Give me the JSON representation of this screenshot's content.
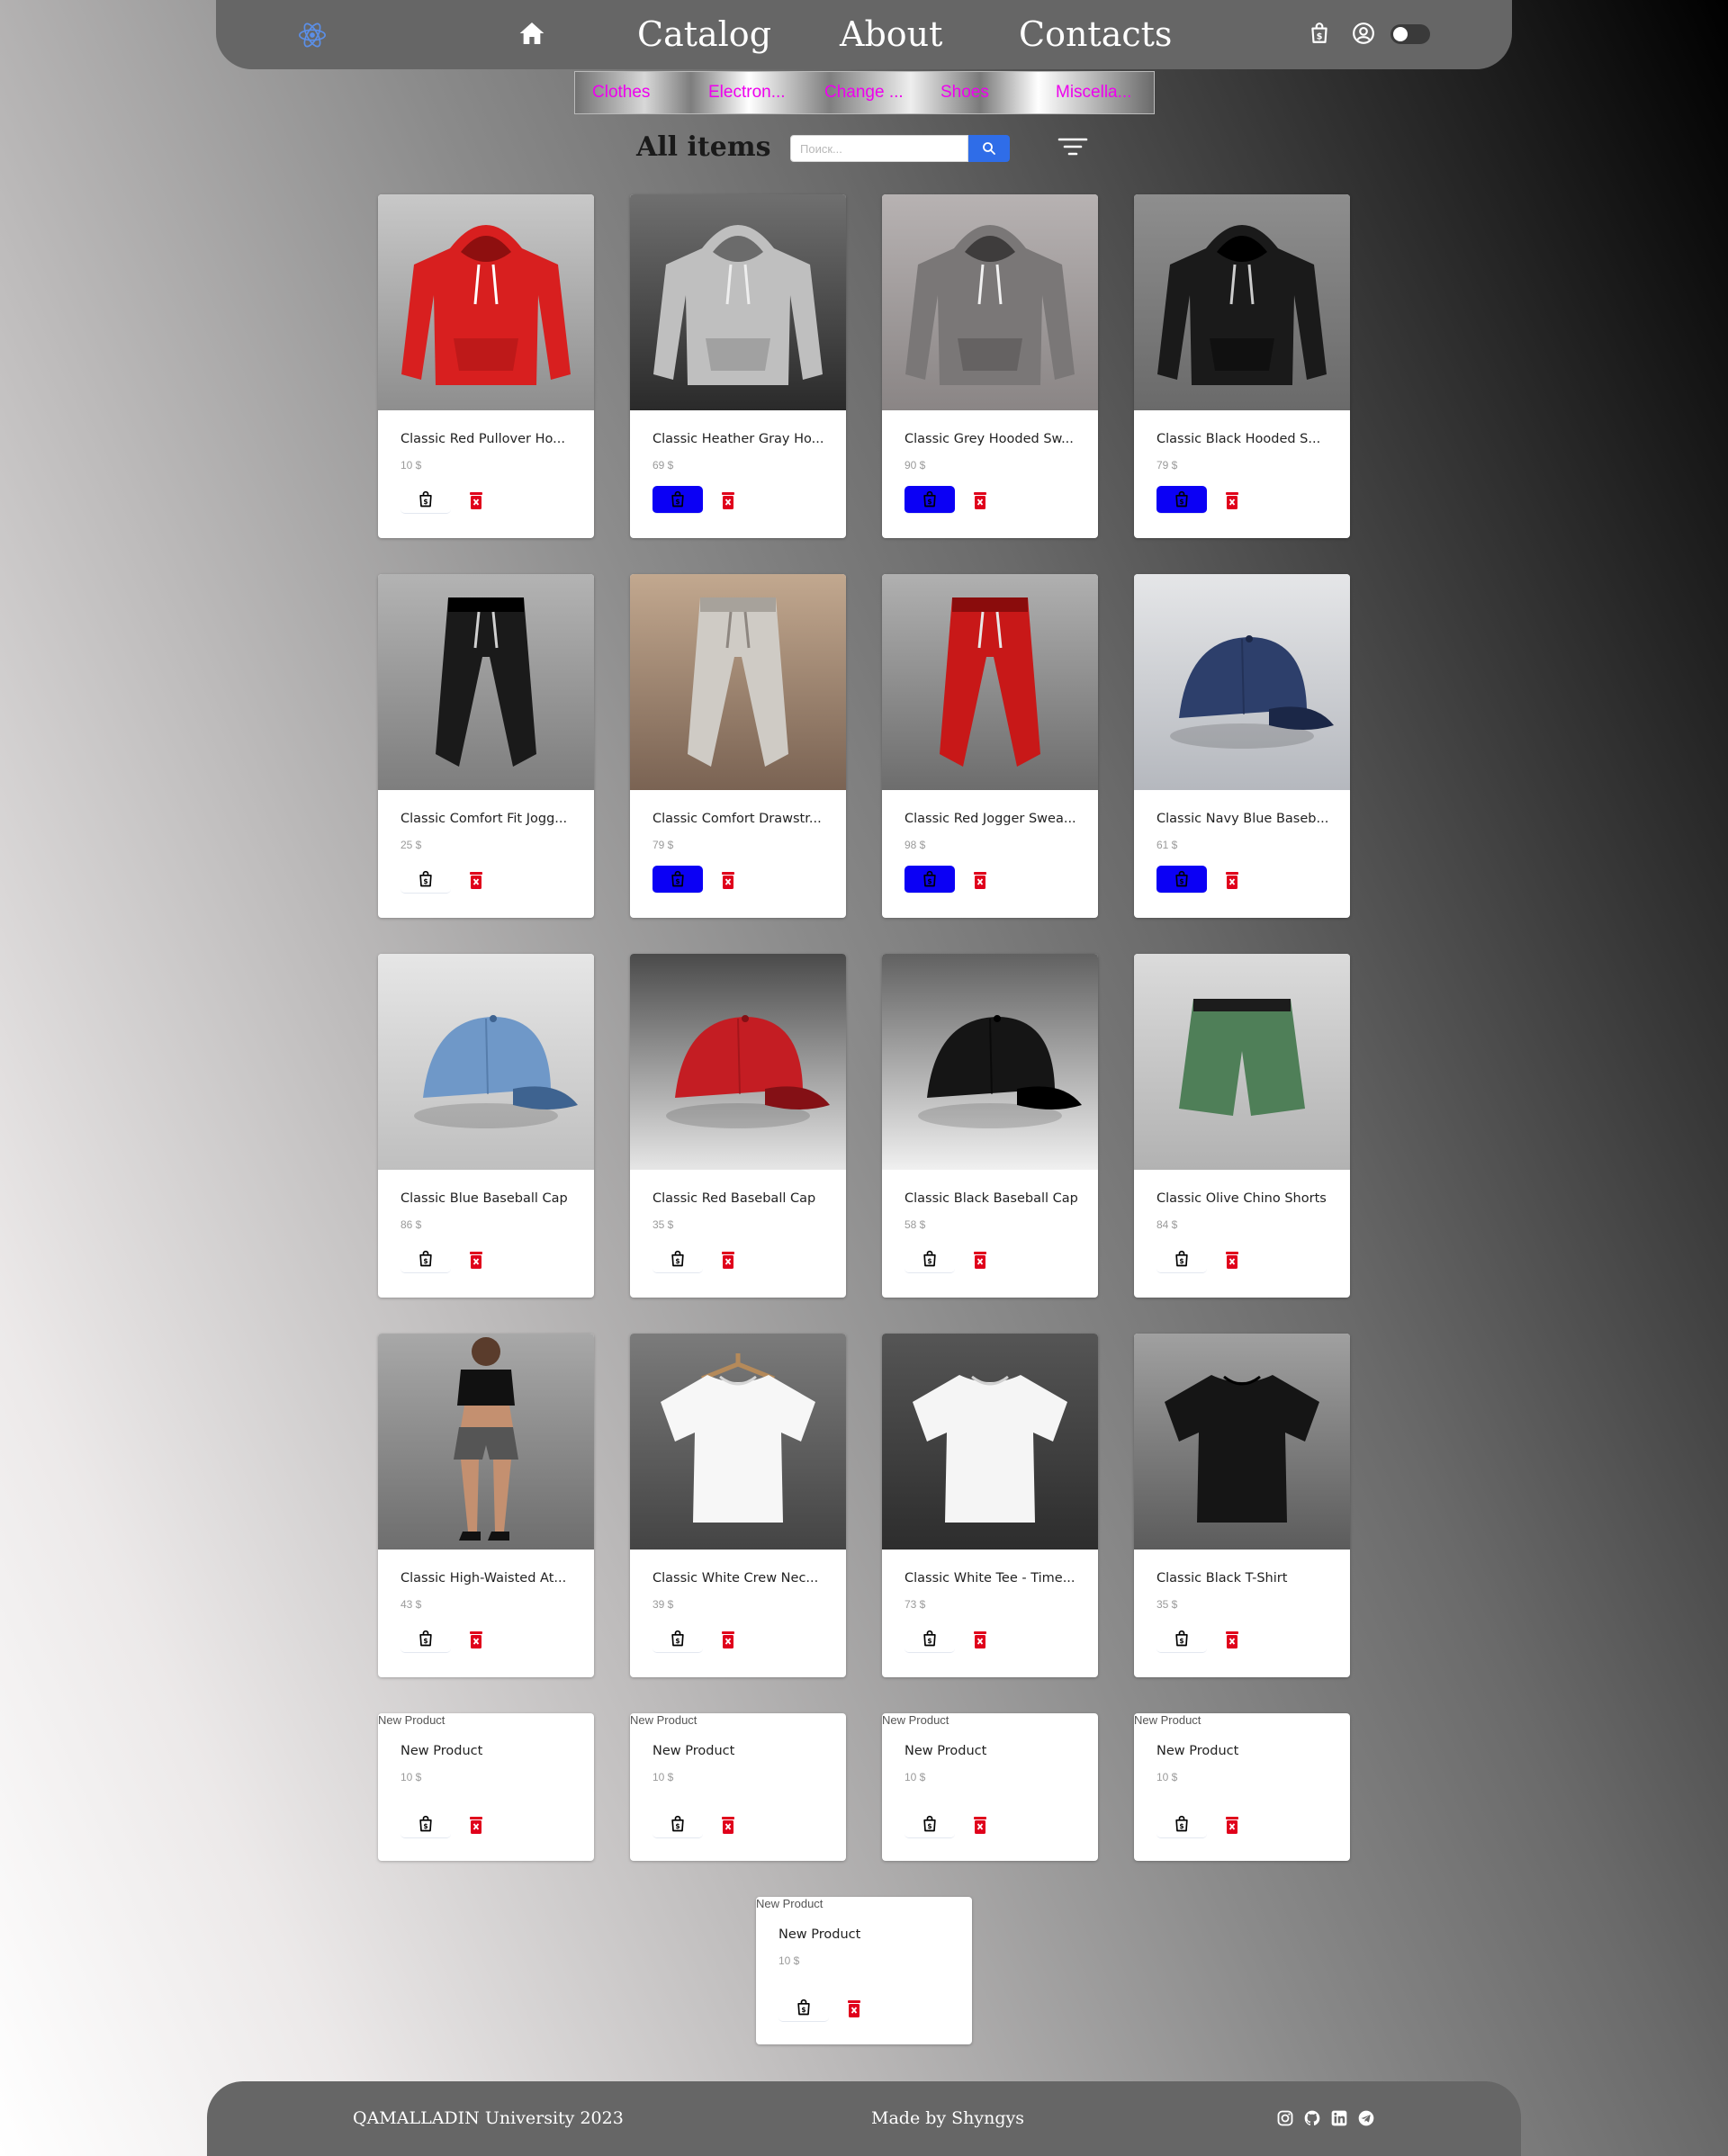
{
  "header": {
    "nav": [
      "Catalog",
      "About",
      "Contacts"
    ]
  },
  "categories": [
    "Clothes",
    "Electron...",
    "Change ...",
    "Shoes",
    "Miscella..."
  ],
  "toolbar": {
    "title": "All items",
    "search_placeholder": "Поиск..."
  },
  "products": [
    {
      "title": "Classic Red Pullover Ho...",
      "price": "10 $",
      "in_cart": false,
      "image": "red-hoodie"
    },
    {
      "title": "Classic Heather Gray Ho...",
      "price": "69 $",
      "in_cart": true,
      "image": "gray-hoodie"
    },
    {
      "title": "Classic Grey Hooded Sw...",
      "price": "90 $",
      "in_cart": true,
      "image": "grey-hoodie"
    },
    {
      "title": "Classic Black Hooded S...",
      "price": "79 $",
      "in_cart": true,
      "image": "black-hoodie"
    },
    {
      "title": "Classic Comfort Fit Jogg...",
      "price": "25 $",
      "in_cart": false,
      "image": "black-joggers"
    },
    {
      "title": "Classic Comfort Drawstr...",
      "price": "79 $",
      "in_cart": true,
      "image": "beige-pants"
    },
    {
      "title": "Classic Red Jogger Swea...",
      "price": "98 $",
      "in_cart": true,
      "image": "red-joggers"
    },
    {
      "title": "Classic Navy Blue Baseb...",
      "price": "61 $",
      "in_cart": true,
      "image": "navy-cap"
    },
    {
      "title": "Classic Blue Baseball Cap",
      "price": "86 $",
      "in_cart": false,
      "image": "blue-cap"
    },
    {
      "title": "Classic Red Baseball Cap",
      "price": "35 $",
      "in_cart": false,
      "image": "red-cap"
    },
    {
      "title": "Classic Black Baseball Cap",
      "price": "58 $",
      "in_cart": false,
      "image": "black-cap"
    },
    {
      "title": "Classic Olive Chino Shorts",
      "price": "84 $",
      "in_cart": false,
      "image": "olive-shorts"
    },
    {
      "title": "Classic High-Waisted At...",
      "price": "43 $",
      "in_cart": false,
      "image": "athletic-shorts"
    },
    {
      "title": "Classic White Crew Nec...",
      "price": "39 $",
      "in_cart": false,
      "image": "white-tee-hanger"
    },
    {
      "title": "Classic White Tee - Time...",
      "price": "73 $",
      "in_cart": false,
      "image": "white-tee"
    },
    {
      "title": "Classic Black T-Shirt",
      "price": "35 $",
      "in_cart": false,
      "image": "black-tee"
    },
    {
      "title": "New Product",
      "price": "10 $",
      "in_cart": false,
      "image": null,
      "alt": "New Product"
    },
    {
      "title": "New Product",
      "price": "10 $",
      "in_cart": false,
      "image": null,
      "alt": "New Product"
    },
    {
      "title": "New Product",
      "price": "10 $",
      "in_cart": false,
      "image": null,
      "alt": "New Product"
    },
    {
      "title": "New Product",
      "price": "10 $",
      "in_cart": false,
      "image": null,
      "alt": "New Product"
    },
    {
      "title": "New Product",
      "price": "10 $",
      "in_cart": false,
      "image": null,
      "alt": "New Product"
    }
  ],
  "footer": {
    "left": "QAMALLADIN University 2023",
    "center": "Made by Shyngys",
    "social_icons": [
      "instagram-icon",
      "github-icon",
      "linkedin-icon",
      "telegram-icon"
    ]
  },
  "colors": {
    "header_bg": "#666666",
    "category_text": "#ee00ee",
    "search_button": "#2f6de8",
    "cart_active": "#0b00f5",
    "delete_icon": "#e0001b"
  }
}
